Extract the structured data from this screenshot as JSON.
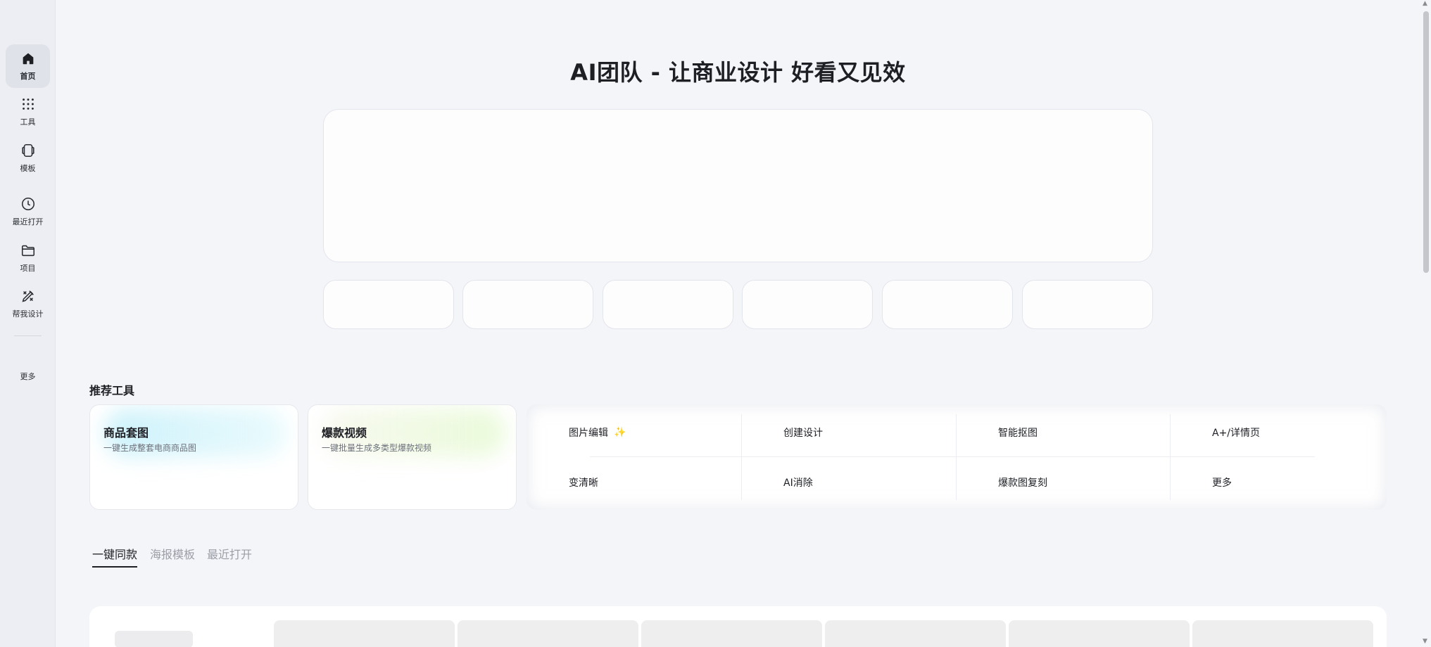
{
  "sidebar": {
    "items": [
      {
        "label": "首页",
        "icon": "home-icon"
      },
      {
        "label": "工具",
        "icon": "grid-icon"
      },
      {
        "label": "模板",
        "icon": "template-icon"
      },
      {
        "label": "最近打开",
        "icon": "clock-icon"
      },
      {
        "label": "项目",
        "icon": "folder-icon"
      },
      {
        "label": "帮我设计",
        "icon": "design-tools-icon"
      }
    ],
    "more_label": "更多"
  },
  "hero": {
    "title": "AI团队 - 让商业设计 好看又见效"
  },
  "recommended": {
    "title": "推荐工具",
    "cards": [
      {
        "title": "商品套图",
        "subtitle": "一键生成整套电商商品图"
      },
      {
        "title": "爆款视频",
        "subtitle": "一键批量生成多类型爆款视频"
      }
    ],
    "tools": [
      "图片编辑",
      "创建设计",
      "智能抠图",
      "A+/详情页",
      "变清晰",
      "AI消除",
      "爆款图复刻",
      "更多"
    ],
    "sparkle_icon": "sparkle-icon"
  },
  "tabs": [
    "一键同款",
    "海报模板",
    "最近打开"
  ],
  "colors": {
    "background": "#f4f5f9",
    "sidebar": "#eceef3",
    "sidebar_active": "#dfe2e9",
    "text_primary": "#1d1f24",
    "text_muted": "#9b9ea6",
    "sparkle": "#f0a53a"
  }
}
